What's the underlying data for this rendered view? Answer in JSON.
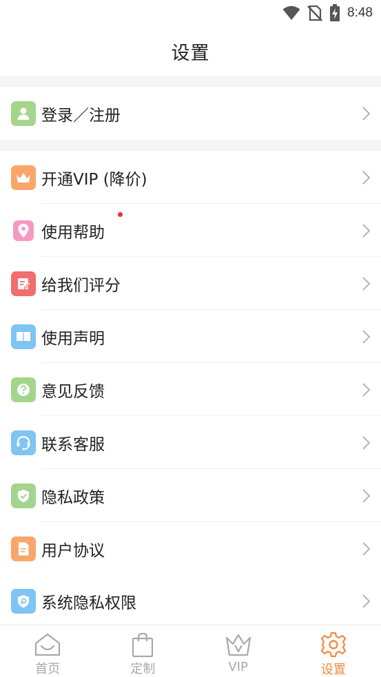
{
  "status_bar": {
    "time": "8:48"
  },
  "header": {
    "title": "设置"
  },
  "account": {
    "label": "登录／注册"
  },
  "menu": {
    "items": [
      {
        "label": "开通VIP (降价)",
        "icon": "crown-icon",
        "color": "#f9a66a"
      },
      {
        "label": "使用帮助",
        "icon": "location-pin-icon",
        "color": "#f49ac1",
        "badge_dot": true
      },
      {
        "label": "给我们评分",
        "icon": "edit-note-icon",
        "color": "#f26d6d"
      },
      {
        "label": "使用声明",
        "icon": "book-icon",
        "color": "#7fc4f2"
      },
      {
        "label": "意见反馈",
        "icon": "question-icon",
        "color": "#a4d58c"
      },
      {
        "label": "联系客服",
        "icon": "headset-icon",
        "color": "#7fc4f2"
      },
      {
        "label": "隐私政策",
        "icon": "shield-check-icon",
        "color": "#a4d58c"
      },
      {
        "label": "用户协议",
        "icon": "document-icon",
        "color": "#f9a66a"
      },
      {
        "label": "系统隐私权限",
        "icon": "shield-search-icon",
        "color": "#7fc4f2"
      }
    ]
  },
  "tabs": [
    {
      "label": "首页",
      "icon": "home-icon"
    },
    {
      "label": "定制",
      "icon": "bag-icon"
    },
    {
      "label": "VIP",
      "icon": "vip-crown-icon"
    },
    {
      "label": "设置",
      "icon": "gear-icon",
      "active": true
    }
  ],
  "colors": {
    "accent": "#f08a3e",
    "inactive_tab": "#a8a8a8",
    "account_icon": "#a4d58c"
  }
}
